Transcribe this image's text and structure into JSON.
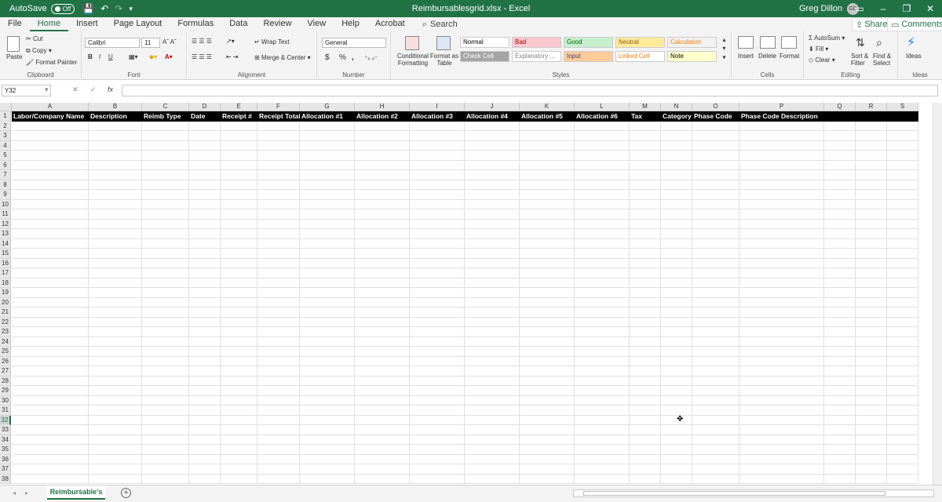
{
  "titlebar": {
    "autosave_label": "AutoSave",
    "autosave_state": "Off",
    "document_title": "Reimbursablesgrid.xlsx  -  Excel",
    "user_name": "Greg Dillon",
    "user_initials": "GD"
  },
  "tabs": [
    "File",
    "Home",
    "Insert",
    "Page Layout",
    "Formulas",
    "Data",
    "Review",
    "View",
    "Help",
    "Acrobat"
  ],
  "active_tab": "Home",
  "search_label": "Search",
  "share_label": "Share",
  "comments_label": "Comments",
  "ribbon": {
    "clipboard": {
      "paste": "Paste",
      "cut": "Cut",
      "copy": "Copy",
      "format_painter": "Format Painter",
      "label": "Clipboard"
    },
    "font": {
      "name": "Calibri",
      "size": "11",
      "label": "Font",
      "bold": "B",
      "italic": "I",
      "underline": "U"
    },
    "alignment": {
      "wrap": "Wrap Text",
      "merge": "Merge & Center",
      "label": "Alignment"
    },
    "number": {
      "format": "General",
      "currency": "$",
      "percent": "%",
      "comma": ",",
      "label": "Number"
    },
    "conditional_formatting": "Conditional Formatting",
    "format_as_table": "Format as Table",
    "styles": {
      "label": "Styles",
      "items": [
        {
          "name": "Normal",
          "bg": "#ffffff",
          "fg": "#000000"
        },
        {
          "name": "Bad",
          "bg": "#ffc7ce",
          "fg": "#9c0006"
        },
        {
          "name": "Good",
          "bg": "#c6efce",
          "fg": "#006100"
        },
        {
          "name": "Neutral",
          "bg": "#ffeb9c",
          "fg": "#9c5700"
        },
        {
          "name": "Calculation",
          "bg": "#f2f2f2",
          "fg": "#fa7d00"
        },
        {
          "name": "Check Cell",
          "bg": "#a5a5a5",
          "fg": "#ffffff"
        },
        {
          "name": "Explanatory ...",
          "bg": "#ffffff",
          "fg": "#7f7f7f"
        },
        {
          "name": "Input",
          "bg": "#ffcc99",
          "fg": "#3f3f76"
        },
        {
          "name": "Linked Cell",
          "bg": "#ffffff",
          "fg": "#fa7d00"
        },
        {
          "name": "Note",
          "bg": "#ffffcc",
          "fg": "#000000"
        }
      ]
    },
    "cells": {
      "insert": "Insert",
      "delete": "Delete",
      "format": "Format",
      "label": "Cells"
    },
    "editing": {
      "autosum": "AutoSum",
      "fill": "Fill",
      "clear": "Clear",
      "sort": "Sort & Filter",
      "find": "Find & Select",
      "label": "Editing"
    },
    "ideas": {
      "button": "Ideas",
      "label": "Ideas"
    }
  },
  "formula_bar": {
    "name_box": "Y32",
    "fx": "fx",
    "formula": ""
  },
  "grid": {
    "columns": [
      "A",
      "B",
      "C",
      "D",
      "E",
      "F",
      "G",
      "H",
      "I",
      "J",
      "K",
      "L",
      "M",
      "N",
      "O",
      "P",
      "Q",
      "R",
      "S"
    ],
    "row_count": 38,
    "selected_row": 32,
    "headers": [
      "Labor/Company Name",
      "Description",
      "Reimb Type",
      "Date",
      "Receipt #",
      "Receipt Total",
      "Allocation #1",
      "Allocation #2",
      "Allocation #3",
      "Allocation #4",
      "Allocation #5",
      "Allocation #6",
      "Tax",
      "Category",
      "Phase Code",
      "Phase Code Description"
    ]
  },
  "sheet_tab": "Reimbursable's",
  "colors": {
    "brand": "#217346",
    "header_bg": "#000000",
    "header_fg": "#ffffff"
  }
}
